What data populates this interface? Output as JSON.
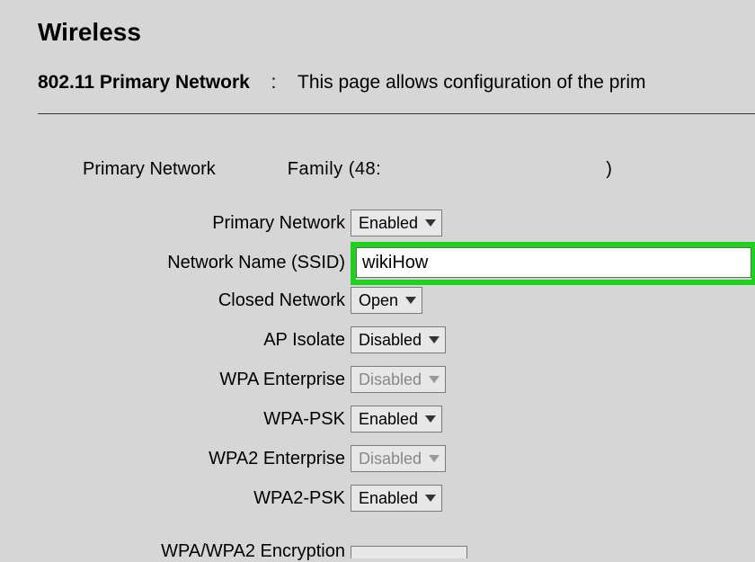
{
  "page": {
    "title": "Wireless",
    "subtitle_bold": "802.11 Primary Network",
    "subtitle_text": "This page allows configuration of the prim"
  },
  "summary": {
    "label": "Primary Network",
    "name": "Family (48:",
    "paren_close": ")"
  },
  "fields": {
    "primary_network": {
      "label": "Primary Network",
      "value": "Enabled"
    },
    "ssid": {
      "label": "Network Name (SSID)",
      "value": "wikiHow"
    },
    "closed_network": {
      "label": "Closed Network",
      "value": "Open"
    },
    "ap_isolate": {
      "label": "AP Isolate",
      "value": "Disabled"
    },
    "wpa_enterprise": {
      "label": "WPA Enterprise",
      "value": "Disabled"
    },
    "wpa_psk": {
      "label": "WPA-PSK",
      "value": "Enabled"
    },
    "wpa2_enterprise": {
      "label": "WPA2 Enterprise",
      "value": "Disabled"
    },
    "wpa2_psk": {
      "label": "WPA2-PSK",
      "value": "Enabled"
    },
    "encryption_partial": {
      "label": "WPA/WPA2 Encryption"
    }
  }
}
